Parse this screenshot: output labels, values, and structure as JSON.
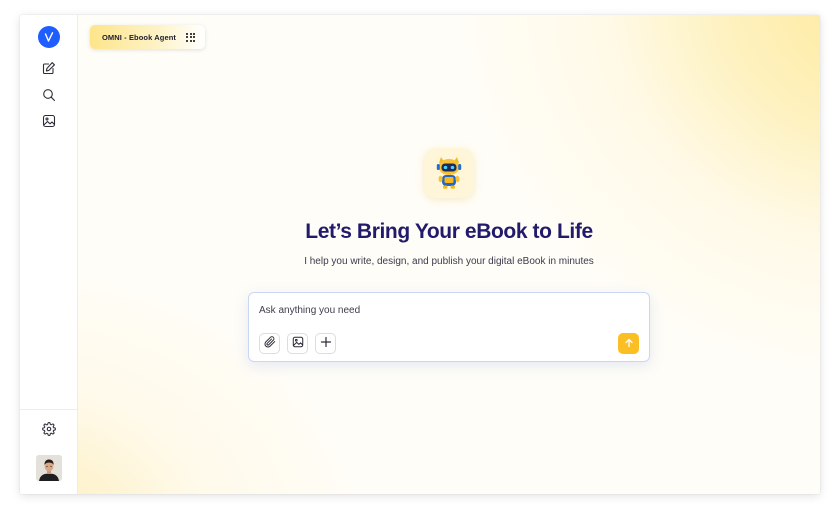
{
  "sidebar": {
    "logo_icon": "brand-logo-v",
    "items": [
      {
        "name": "new-chat",
        "icon": "edit-icon"
      },
      {
        "name": "search",
        "icon": "search-icon"
      },
      {
        "name": "gallery",
        "icon": "image-icon"
      }
    ],
    "settings_icon": "gear-icon",
    "avatar": "user-avatar"
  },
  "header": {
    "agent_chip_label": "OMNI - Ebook Agent",
    "agent_chip_icon": "grid-icon"
  },
  "hero": {
    "mascot": "robot-mascot",
    "title": "Let’s Bring Your eBook to Life",
    "subtitle": "I help you write, design, and publish your digital eBook in minutes"
  },
  "composer": {
    "placeholder": "Ask anything you need",
    "value": "",
    "tools": [
      {
        "name": "attach",
        "icon": "paperclip-icon"
      },
      {
        "name": "image",
        "icon": "image-icon"
      },
      {
        "name": "more",
        "icon": "plus-icon"
      }
    ],
    "send_icon": "arrow-up-icon"
  },
  "colors": {
    "brand_blue": "#1e5eff",
    "title_navy": "#221b6b",
    "send_yellow": "#fbbf24",
    "chip_yellow": "#fde58a"
  }
}
